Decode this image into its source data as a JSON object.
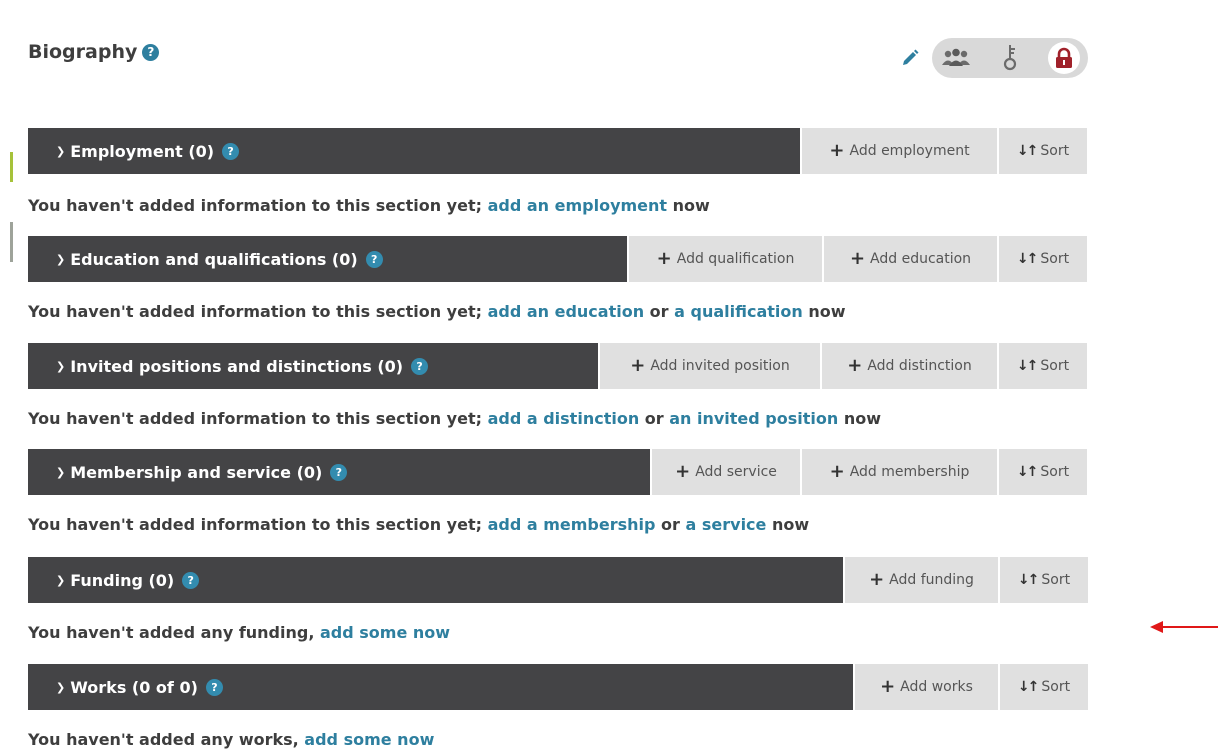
{
  "biography": {
    "title": "Biography",
    "help_glyph": "?",
    "edit_icon": "pencil-icon",
    "visibility_options": [
      "everyone-icon",
      "trusted-parties-icon",
      "only-me-lock-icon"
    ]
  },
  "colors": {
    "section_bar": "#444446",
    "button_bg": "#e0e0e0",
    "link": "#2e7f9f",
    "private_selected": "#a0212a",
    "annotation_arrow": "#e01818"
  },
  "sections": [
    {
      "title": "Employment (0)",
      "buttons": [
        {
          "label": "Add employment"
        }
      ],
      "sort_label": "Sort",
      "message": {
        "prefix": "You haven't added information to this section yet; ",
        "link1": "add an employment",
        "mid": "",
        "link2": "",
        "suffix": " now"
      }
    },
    {
      "title": "Education and qualifications (0)",
      "buttons": [
        {
          "label": "Add qualification"
        },
        {
          "label": "Add education"
        }
      ],
      "sort_label": "Sort",
      "message": {
        "prefix": "You haven't added information to this section yet; ",
        "link1": "add an education",
        "mid": " or ",
        "link2": "a qualification",
        "suffix": " now"
      }
    },
    {
      "title": "Invited positions and distinctions (0)",
      "buttons": [
        {
          "label": "Add invited position"
        },
        {
          "label": "Add distinction"
        }
      ],
      "sort_label": "Sort",
      "message": {
        "prefix": "You haven't added information to this section yet; ",
        "link1": "add a distinction",
        "mid": " or ",
        "link2": "an invited position",
        "suffix": " now"
      }
    },
    {
      "title": "Membership and service (0)",
      "buttons": [
        {
          "label": "Add service"
        },
        {
          "label": "Add membership"
        }
      ],
      "sort_label": "Sort",
      "message": {
        "prefix": "You haven't added information to this section yet; ",
        "link1": "add a membership",
        "mid": " or ",
        "link2": "a service",
        "suffix": " now"
      }
    },
    {
      "title": "Funding (0)",
      "buttons": [
        {
          "label": "Add funding"
        }
      ],
      "sort_label": "Sort",
      "message": {
        "prefix": "You haven't added any funding, ",
        "link1": "add some now",
        "mid": "",
        "link2": "",
        "suffix": ""
      }
    },
    {
      "title": "Works (0 of 0)",
      "buttons": [
        {
          "label": "Add works"
        }
      ],
      "sort_label": "Sort",
      "message": {
        "prefix": "You haven't added any works, ",
        "link1": "add some now",
        "mid": "",
        "link2": "",
        "suffix": ""
      }
    }
  ]
}
